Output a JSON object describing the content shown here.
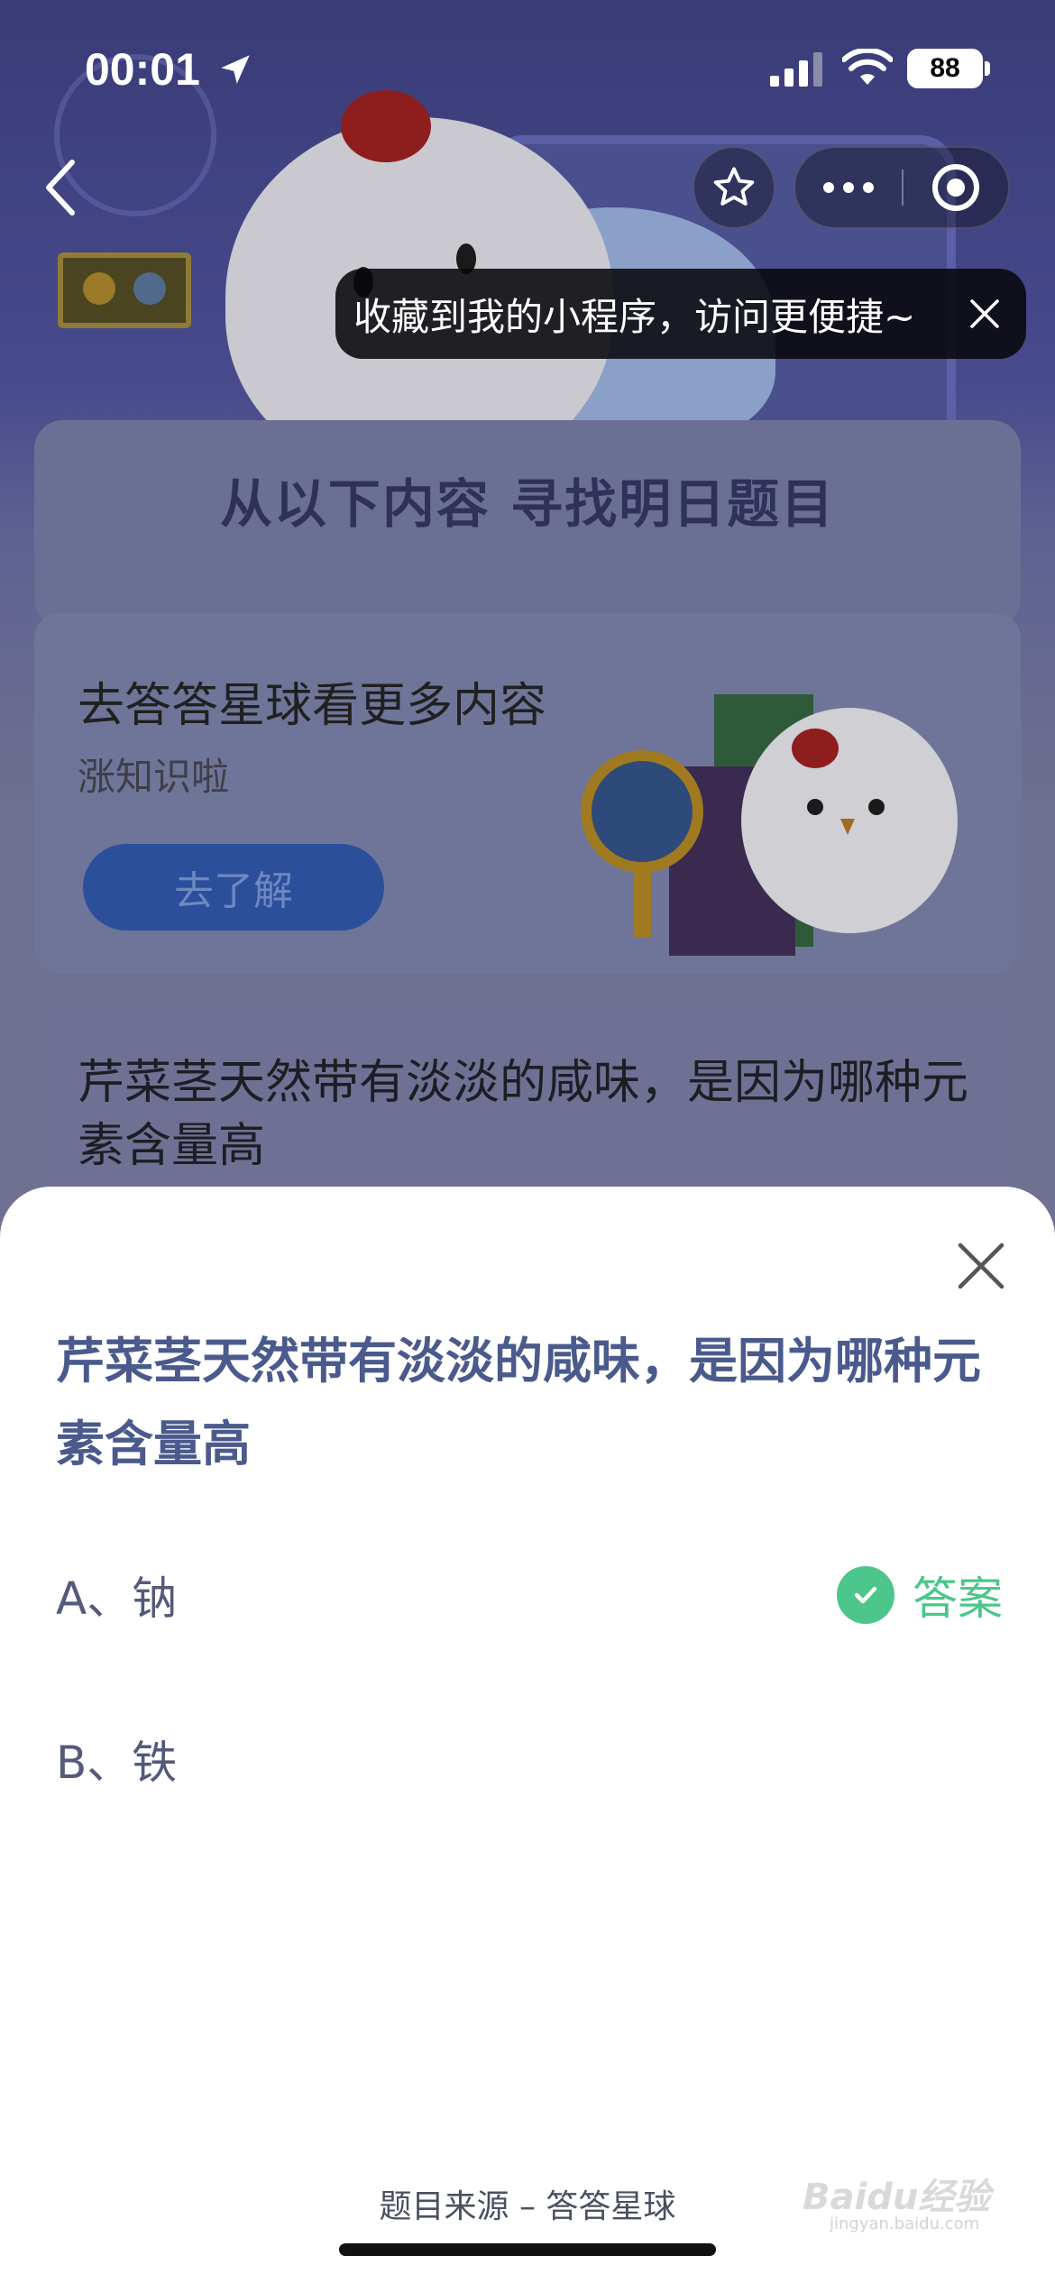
{
  "status_bar": {
    "time": "00:01",
    "battery": "88"
  },
  "nav": {
    "tip_text": "收藏到我的小程序，访问更便捷~"
  },
  "background": {
    "heading": "从以下内容 寻找明日题目",
    "promo_title": "去答答星球看更多内容",
    "promo_subtitle": "涨知识啦",
    "promo_button": "去了解",
    "question_preview": "芹菜茎天然带有淡淡的咸味，是因为哪种元素含量高"
  },
  "sheet": {
    "question": "芹菜茎天然带有淡淡的咸味，是因为哪种元素含量高",
    "options": [
      {
        "label": "A、钠",
        "is_answer": true
      },
      {
        "label": "B、铁",
        "is_answer": false
      }
    ],
    "answer_label": "答案",
    "source": "题目来源 – 答答星球"
  },
  "watermark": {
    "text": "Baidu经验",
    "sub": "jingyan.baidu.com"
  },
  "colors": {
    "accent_green": "#4cc68a",
    "question_blue": "#4a5a8c",
    "button_blue": "#2b4f9a"
  }
}
